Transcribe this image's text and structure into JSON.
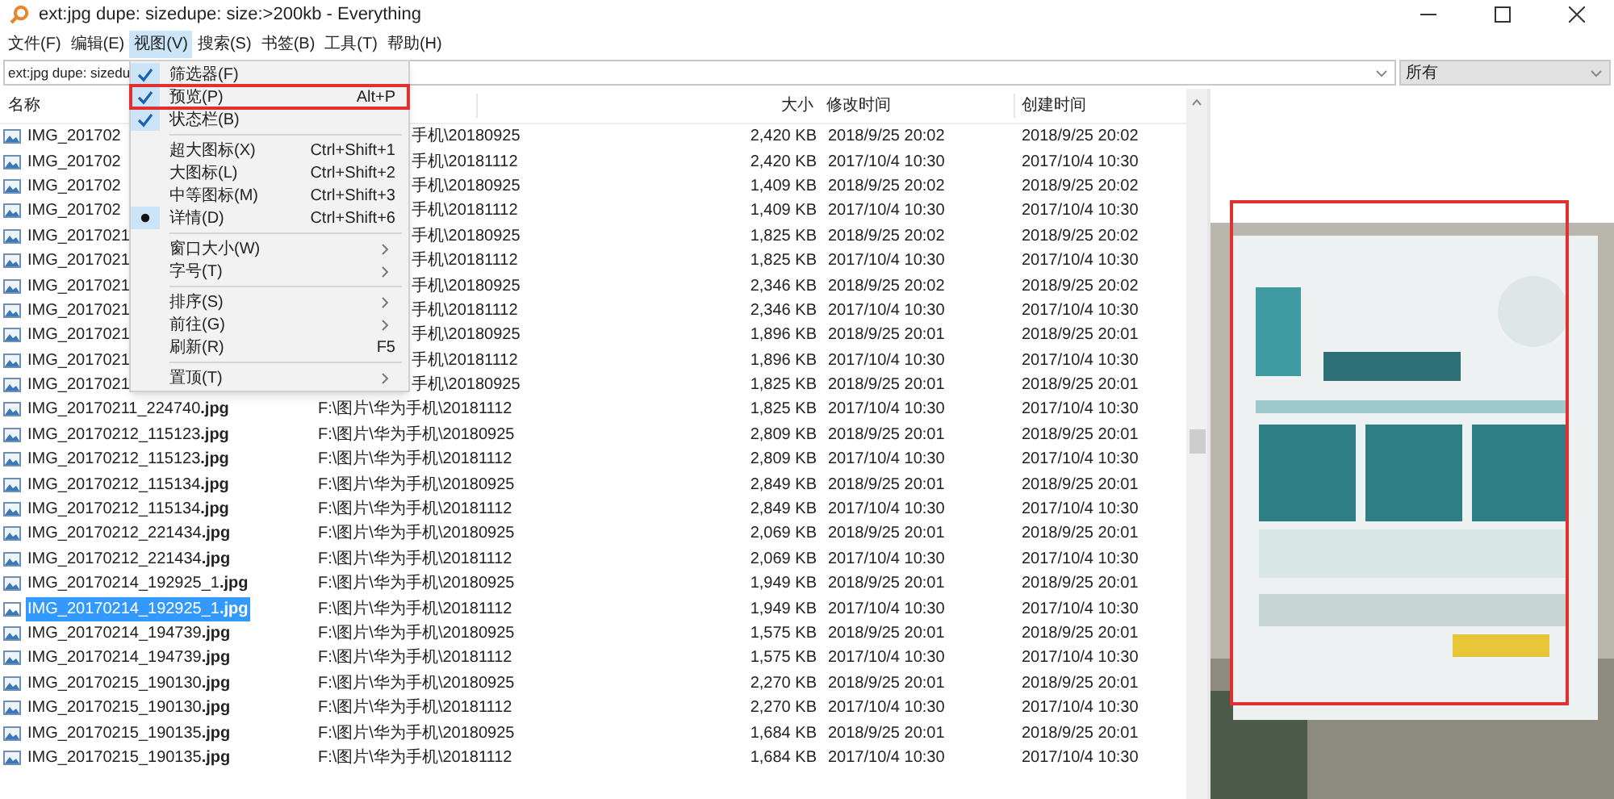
{
  "window": {
    "title": "ext:jpg dupe: sizedupe: size:>200kb - Everything"
  },
  "menubar": [
    {
      "label": "文件(F)",
      "selected": false
    },
    {
      "label": "编辑(E)",
      "selected": false
    },
    {
      "label": "视图(V)",
      "selected": true
    },
    {
      "label": "搜索(S)",
      "selected": false
    },
    {
      "label": "书签(B)",
      "selected": false
    },
    {
      "label": "工具(T)",
      "selected": false
    },
    {
      "label": "帮助(H)",
      "selected": false
    }
  ],
  "search": {
    "value": "ext:jpg dupe: sizedu"
  },
  "filter": {
    "value": "所有"
  },
  "columns": [
    {
      "label": "名称"
    },
    {
      "label": "大小"
    },
    {
      "label": "修改时间"
    },
    {
      "label": "创建时间"
    }
  ],
  "rows": [
    {
      "name": "IMG_201702",
      "path": "手机\\20180925",
      "size": "2,420 KB",
      "modified": "2018/9/25 20:02",
      "created": "2018/9/25 20:02",
      "selected": false
    },
    {
      "name": "IMG_201702",
      "path": "手机\\20181112",
      "size": "2,420 KB",
      "modified": "2017/10/4 10:30",
      "created": "2017/10/4 10:30",
      "selected": false
    },
    {
      "name": "IMG_201702",
      "path": "手机\\20180925",
      "size": "1,409 KB",
      "modified": "2018/9/25 20:02",
      "created": "2018/9/25 20:02",
      "selected": false
    },
    {
      "name": "IMG_201702",
      "path": "手机\\20181112",
      "size": "1,409 KB",
      "modified": "2017/10/4 10:30",
      "created": "2017/10/4 10:30",
      "selected": false
    },
    {
      "name": "IMG_2017021",
      "path": "手机\\20180925",
      "size": "1,825 KB",
      "modified": "2018/9/25 20:02",
      "created": "2018/9/25 20:02",
      "selected": false
    },
    {
      "name": "IMG_2017021",
      "path": "手机\\20181112",
      "size": "1,825 KB",
      "modified": "2017/10/4 10:30",
      "created": "2017/10/4 10:30",
      "selected": false
    },
    {
      "name": "IMG_2017021",
      "path": "手机\\20180925",
      "size": "2,346 KB",
      "modified": "2018/9/25 20:02",
      "created": "2018/9/25 20:02",
      "selected": false
    },
    {
      "name": "IMG_2017021",
      "path": "手机\\20181112",
      "size": "2,346 KB",
      "modified": "2017/10/4 10:30",
      "created": "2017/10/4 10:30",
      "selected": false
    },
    {
      "name": "IMG_2017021",
      "path": "手机\\20180925",
      "size": "1,896 KB",
      "modified": "2018/9/25 20:01",
      "created": "2018/9/25 20:01",
      "selected": false
    },
    {
      "name": "IMG_2017021",
      "path": "手机\\20181112",
      "size": "1,896 KB",
      "modified": "2017/10/4 10:30",
      "created": "2017/10/4 10:30",
      "selected": false
    },
    {
      "name": "IMG_2017021",
      "path": "手机\\20180925",
      "size": "1,825 KB",
      "modified": "2018/9/25 20:01",
      "created": "2018/9/25 20:01",
      "selected": false
    },
    {
      "name": "IMG_20170211_224740**.jpg**",
      "path": "F:\\图片\\华为手机\\20181112",
      "size": "1,825 KB",
      "modified": "2017/10/4 10:30",
      "created": "2017/10/4 10:30",
      "selected": false
    },
    {
      "name": "IMG_20170212_115123**.jpg**",
      "path": "F:\\图片\\华为手机\\20180925",
      "size": "2,809 KB",
      "modified": "2018/9/25 20:01",
      "created": "2018/9/25 20:01",
      "selected": false
    },
    {
      "name": "IMG_20170212_115123**.jpg**",
      "path": "F:\\图片\\华为手机\\20181112",
      "size": "2,809 KB",
      "modified": "2017/10/4 10:30",
      "created": "2017/10/4 10:30",
      "selected": false
    },
    {
      "name": "IMG_20170212_115134**.jpg**",
      "path": "F:\\图片\\华为手机\\20180925",
      "size": "2,849 KB",
      "modified": "2018/9/25 20:01",
      "created": "2018/9/25 20:01",
      "selected": false
    },
    {
      "name": "IMG_20170212_115134**.jpg**",
      "path": "F:\\图片\\华为手机\\20181112",
      "size": "2,849 KB",
      "modified": "2017/10/4 10:30",
      "created": "2017/10/4 10:30",
      "selected": false
    },
    {
      "name": "IMG_20170212_221434**.jpg**",
      "path": "F:\\图片\\华为手机\\20180925",
      "size": "2,069 KB",
      "modified": "2018/9/25 20:01",
      "created": "2018/9/25 20:01",
      "selected": false
    },
    {
      "name": "IMG_20170212_221434**.jpg**",
      "path": "F:\\图片\\华为手机\\20181112",
      "size": "2,069 KB",
      "modified": "2017/10/4 10:30",
      "created": "2017/10/4 10:30",
      "selected": false
    },
    {
      "name": "IMG_20170214_192925_1**.jpg**",
      "path": "F:\\图片\\华为手机\\20180925",
      "size": "1,949 KB",
      "modified": "2018/9/25 20:01",
      "created": "2018/9/25 20:01",
      "selected": false
    },
    {
      "name": "IMG_20170214_192925_1**.jpg**",
      "path": "F:\\图片\\华为手机\\20181112",
      "size": "1,949 KB",
      "modified": "2017/10/4 10:30",
      "created": "2017/10/4 10:30",
      "selected": true
    },
    {
      "name": "IMG_20170214_194739**.jpg**",
      "path": "F:\\图片\\华为手机\\20180925",
      "size": "1,575 KB",
      "modified": "2018/9/25 20:01",
      "created": "2018/9/25 20:01",
      "selected": false
    },
    {
      "name": "IMG_20170214_194739**.jpg**",
      "path": "F:\\图片\\华为手机\\20181112",
      "size": "1,575 KB",
      "modified": "2017/10/4 10:30",
      "created": "2017/10/4 10:30",
      "selected": false
    },
    {
      "name": "IMG_20170215_190130**.jpg**",
      "path": "F:\\图片\\华为手机\\20180925",
      "size": "2,270 KB",
      "modified": "2018/9/25 20:01",
      "created": "2018/9/25 20:01",
      "selected": false
    },
    {
      "name": "IMG_20170215_190130**.jpg**",
      "path": "F:\\图片\\华为手机\\20181112",
      "size": "2,270 KB",
      "modified": "2017/10/4 10:30",
      "created": "2017/10/4 10:30",
      "selected": false
    },
    {
      "name": "IMG_20170215_190135**.jpg**",
      "path": "F:\\图片\\华为手机\\20180925",
      "size": "1,684 KB",
      "modified": "2018/9/25 20:01",
      "created": "2018/9/25 20:01",
      "selected": false
    },
    {
      "name": "IMG_20170215_190135**.jpg**",
      "path": "F:\\图片\\华为手机\\20181112",
      "size": "1,684 KB",
      "modified": "2017/10/4 10:30",
      "created": "2017/10/4 10:30",
      "selected": false
    }
  ],
  "view_menu": [
    {
      "kind": "check",
      "label": "筛选器(F)",
      "checked": true,
      "highlighted": false
    },
    {
      "kind": "check",
      "label": "预览(P)",
      "shortcut": "Alt+P",
      "checked": true,
      "highlighted": true
    },
    {
      "kind": "check",
      "label": "状态栏(B)",
      "checked": true,
      "highlighted": false
    },
    {
      "kind": "separator"
    },
    {
      "kind": "radio",
      "label": "超大图标(X)",
      "shortcut": "Ctrl+Shift+1",
      "checked": false,
      "highlighted": false
    },
    {
      "kind": "radio",
      "label": "大图标(L)",
      "shortcut": "Ctrl+Shift+2",
      "checked": false,
      "highlighted": false
    },
    {
      "kind": "radio",
      "label": "中等图标(M)",
      "shortcut": "Ctrl+Shift+3",
      "checked": false,
      "highlighted": false
    },
    {
      "kind": "radio",
      "label": "详情(D)",
      "shortcut": "Ctrl+Shift+6",
      "checked": true,
      "highlighted": false
    },
    {
      "kind": "separator"
    },
    {
      "kind": "submenu",
      "label": "窗口大小(W)",
      "highlighted": false
    },
    {
      "kind": "submenu",
      "label": "字号(T)",
      "highlighted": false
    },
    {
      "kind": "separator"
    },
    {
      "kind": "submenu",
      "label": "排序(S)",
      "highlighted": false
    },
    {
      "kind": "submenu",
      "label": "前往(G)",
      "highlighted": false
    },
    {
      "kind": "plain",
      "label": "刷新(R)",
      "shortcut": "F5",
      "highlighted": false
    },
    {
      "kind": "separator"
    },
    {
      "kind": "submenu",
      "label": "置顶(T)",
      "highlighted": false
    }
  ],
  "preview": {
    "kind": "picture",
    "marked": true
  }
}
